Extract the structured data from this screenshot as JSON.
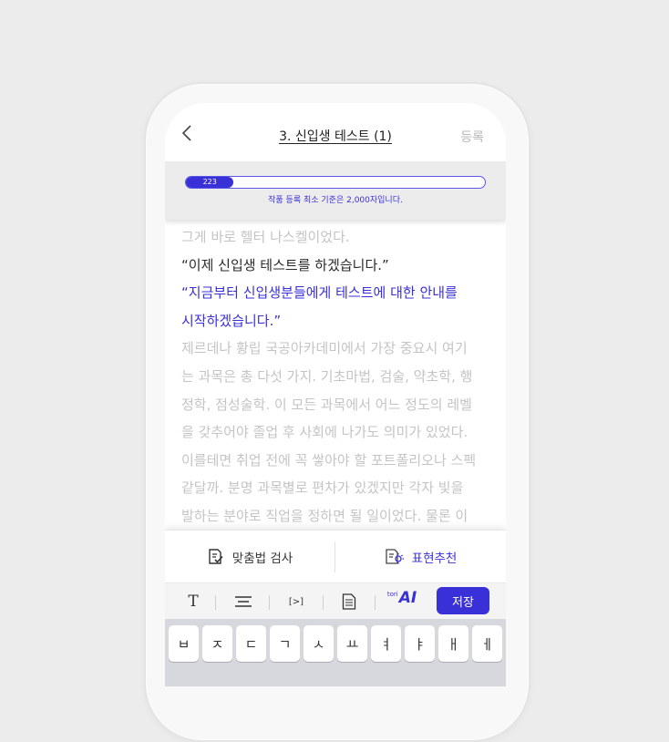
{
  "header": {
    "title": "3. 신입생 테스트 (1)",
    "register_label": "등록"
  },
  "progress": {
    "count_label": "223",
    "fraction": 0.16,
    "note": "작품 등록 최소 기준은 2,000자입니다."
  },
  "editor": {
    "lines": [
      {
        "text": "그게 바로 헬터 나스켈이었다.",
        "style": "gray"
      },
      {
        "text": "“이제 신입생 테스트를 하겠습니다.”",
        "style": "dark"
      },
      {
        "text": "“지금부터 신입생분들에게 테스트에 대한 안내를",
        "style": "blue"
      },
      {
        "text": "시작하겠습니다.”",
        "style": "blue"
      },
      {
        "text": "제르데나 황립 국공아카데미에서 가장 중요시 여기",
        "style": "gray"
      },
      {
        "text": "는 과목은 총 다섯 가지. 기초마법, 검술, 약초학, 행",
        "style": "gray"
      },
      {
        "text": "정학, 점성술학. 이 모든 과목에서 어느 정도의 레벨",
        "style": "gray"
      },
      {
        "text": "을 갖추어야 졸업 후 사회에 나가도 의미가 있었다.",
        "style": "gray"
      },
      {
        "text": "이를테면 취업 전에 꼭 쌓아야 할 포트폴리오나 스펙",
        "style": "gray"
      },
      {
        "text": "같달까. 분명 과목별로 편차가 있겠지만 각자 빛을",
        "style": "gray"
      },
      {
        "text": "발하는 분야로 직업을 정하면 될 일이었다. 물론 이",
        "style": "gray"
      }
    ]
  },
  "helpers": {
    "spellcheck_label": "맞춤법 검사",
    "expression_label": "표현추천"
  },
  "toolbar": {
    "text_glyph": "T",
    "bracket_glyph": "[>]",
    "logo_small": "tori",
    "logo_big": "AI",
    "save_label": "저장"
  },
  "keyboard": {
    "keys": [
      "ㅂ",
      "ㅈ",
      "ㄷ",
      "ㄱ",
      "ㅅ",
      "ㅛ",
      "ㅕ",
      "ㅑ",
      "ㅐ",
      "ㅔ"
    ]
  },
  "colors": {
    "accent": "#3a30d8",
    "muted_text": "#c4c4c4",
    "keyboard_bg": "#d6d8de"
  }
}
